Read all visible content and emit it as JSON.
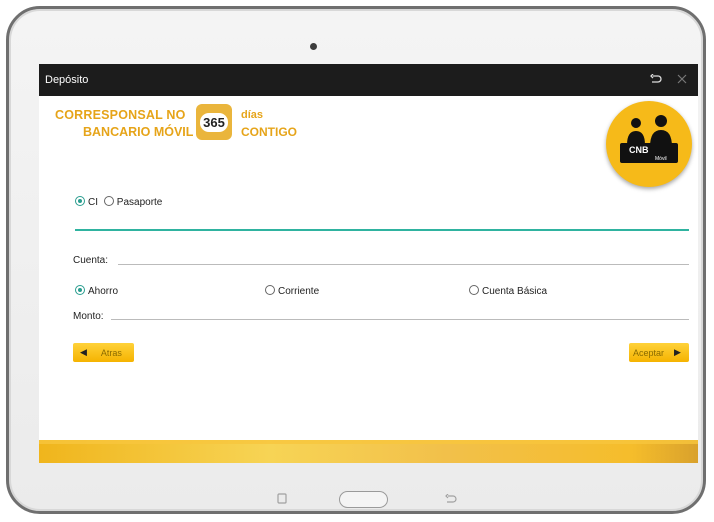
{
  "window": {
    "title": "Depósito"
  },
  "header": {
    "brand_line1": "CORRESPONSAL NO",
    "brand_line2": "BANCARIO MÓVIL",
    "brand_number": "365",
    "brand_days": "días",
    "brand_with_you": "CONTIGO",
    "logo_text": "CNB",
    "logo_sub": "Móvil"
  },
  "document_type": {
    "options": [
      {
        "label": "CI",
        "selected": true
      },
      {
        "label": "Pasaporte",
        "selected": false
      }
    ],
    "value": ""
  },
  "account": {
    "label": "Cuenta:",
    "value": ""
  },
  "account_type": {
    "options": [
      {
        "label": "Ahorro",
        "selected": true
      },
      {
        "label": "Corriente",
        "selected": false
      },
      {
        "label": "Cuenta Básica",
        "selected": false
      }
    ]
  },
  "amount": {
    "label": "Monto:",
    "value": ""
  },
  "buttons": {
    "back": "Atras",
    "accept": "Aceptar"
  },
  "colors": {
    "accent_teal": "#2fb3a0",
    "brand_yellow": "#f6ba19",
    "brand_text": "#e6a419"
  }
}
